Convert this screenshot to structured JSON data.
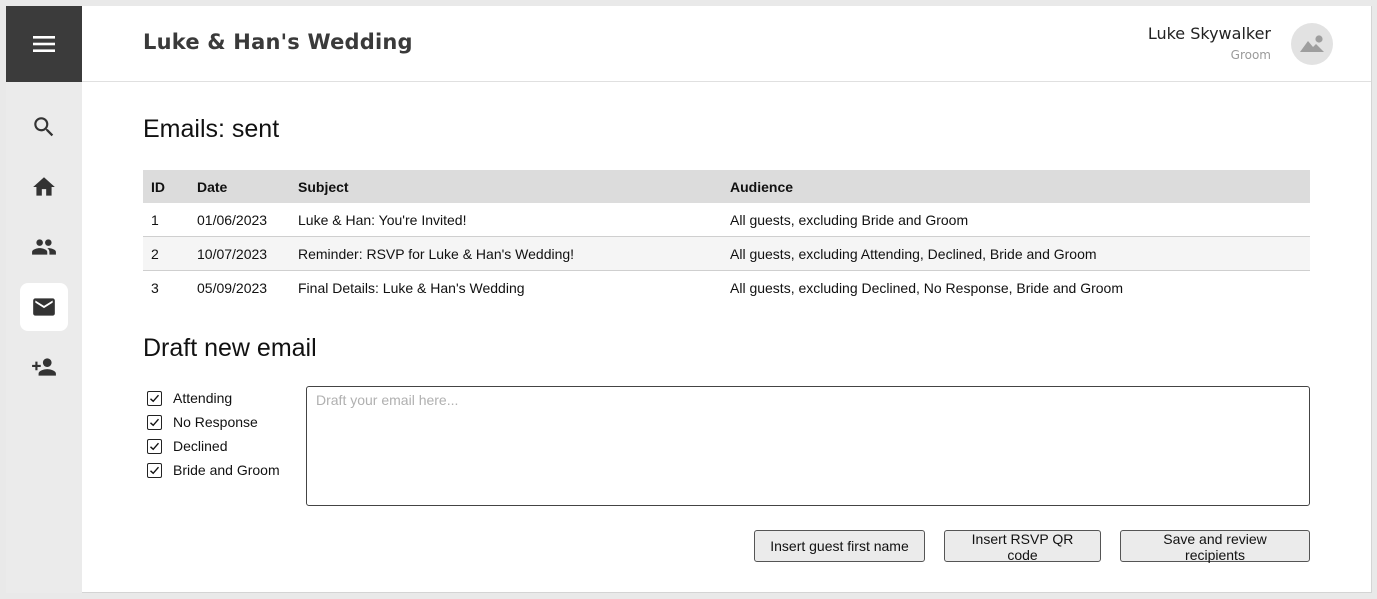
{
  "app": {
    "title": "Luke & Han's Wedding"
  },
  "user": {
    "name": "Luke Skywalker",
    "role": "Groom"
  },
  "sidebar": {
    "items": [
      {
        "name": "search",
        "icon": "search-icon",
        "active": false
      },
      {
        "name": "home",
        "icon": "home-icon",
        "active": false
      },
      {
        "name": "guests",
        "icon": "people-icon",
        "active": false
      },
      {
        "name": "emails",
        "icon": "mail-icon",
        "active": true
      },
      {
        "name": "add-guest",
        "icon": "person-add-icon",
        "active": false
      }
    ]
  },
  "sent": {
    "title": "Emails: sent",
    "columns": [
      "ID",
      "Date",
      "Subject",
      "Audience"
    ],
    "rows": [
      [
        "1",
        "01/06/2023",
        "Luke & Han: You're Invited!",
        "All guests, excluding Bride and Groom"
      ],
      [
        "2",
        "10/07/2023",
        "Reminder: RSVP for Luke & Han's Wedding!",
        "All guests, excluding Attending, Declined, Bride and Groom"
      ],
      [
        "3",
        "05/09/2023",
        "Final Details: Luke & Han's Wedding",
        "All guests, excluding Declined, No Response, Bride and Groom"
      ]
    ]
  },
  "draft": {
    "title": "Draft new email",
    "placeholder": "Draft your email here...",
    "filters": [
      {
        "label": "Attending",
        "checked": true
      },
      {
        "label": "No Response",
        "checked": true
      },
      {
        "label": "Declined",
        "checked": true
      },
      {
        "label": "Bride and Groom",
        "checked": true
      }
    ],
    "buttons": {
      "insert_name": "Insert guest first name",
      "insert_qr": "Insert RSVP QR code",
      "save": "Save and review recipients"
    }
  }
}
